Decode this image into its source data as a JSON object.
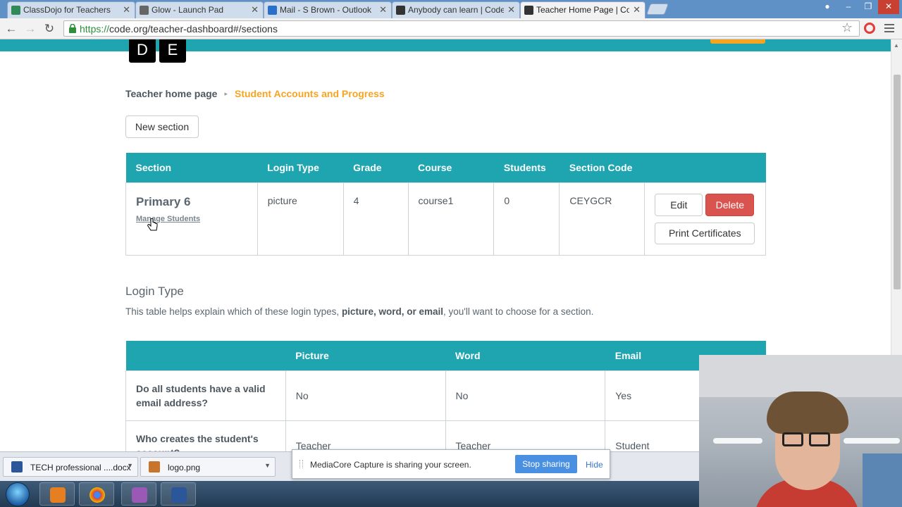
{
  "browser": {
    "tabs": [
      {
        "title": "ClassDojo for Teachers",
        "active": false,
        "favicon_color": "#2e8b57"
      },
      {
        "title": "Glow - Launch Pad",
        "active": false,
        "favicon_color": "#666666"
      },
      {
        "title": "Mail - S Brown - Outlook",
        "active": false,
        "favicon_color": "#2a6fc9"
      },
      {
        "title": "Anybody can learn | Code",
        "active": false,
        "favicon_color": "#333333"
      },
      {
        "title": "Teacher Home Page | Cod",
        "active": true,
        "favicon_color": "#333333"
      }
    ],
    "url_scheme": "https://",
    "url_rest": "code.org/teacher-dashboard#/sections",
    "close_glyph": "✕"
  },
  "header": {
    "logo_letters": [
      "D",
      "E"
    ]
  },
  "breadcrumb": {
    "home": "Teacher home page",
    "separator": "▸",
    "current": "Student Accounts and Progress"
  },
  "buttons": {
    "new_section": "New section",
    "edit": "Edit",
    "delete": "Delete",
    "print_certificates": "Print Certificates"
  },
  "sections_table": {
    "headers": [
      "Section",
      "Login Type",
      "Grade",
      "Course",
      "Students",
      "Section Code"
    ],
    "rows": [
      {
        "section": "Primary 6",
        "manage_link": "Manage Students",
        "login_type": "picture",
        "grade": "4",
        "course": "course1",
        "students": "0",
        "section_code": "CEYGCR"
      }
    ]
  },
  "login_type": {
    "heading": "Login Type",
    "intro_before": "This table helps explain which of these login types, ",
    "intro_bold": "picture, word, or email",
    "intro_after": ", you'll want to choose for a section.",
    "headers": [
      "",
      "Picture",
      "Word",
      "Email"
    ],
    "rows": [
      {
        "question": "Do all students have a valid email address?",
        "picture": "No",
        "word": "No",
        "email": "Yes"
      },
      {
        "question": "Who creates the student's account?",
        "picture": "Teacher",
        "word": "Teacher",
        "email": "Student"
      }
    ]
  },
  "downloads": [
    {
      "name": "TECH  professional ....docx",
      "icon_color": "#2b579a"
    },
    {
      "name": "logo.png",
      "icon_color": "#c8742b"
    }
  ],
  "share_bar": {
    "message": "MediaCore Capture is sharing your screen.",
    "stop": "Stop sharing",
    "hide": "Hide"
  },
  "colors": {
    "teal": "#1fa5b0",
    "orange": "#f7a421",
    "danger": "#d9534f",
    "text": "#4d575f"
  }
}
